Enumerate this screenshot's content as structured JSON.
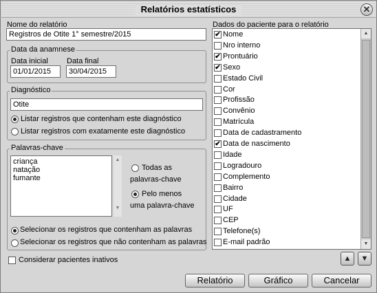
{
  "window": {
    "title": "Relatórios estatísticos",
    "close_icon": "close-icon"
  },
  "report_name": {
    "label": "Nome do relatório",
    "value": "Registros de Otite 1° semestre/2015"
  },
  "anamnese": {
    "legend": "Data da anamnese",
    "start_label": "Data inicial",
    "start_value": "01/01/2015",
    "end_label": "Data final",
    "end_value": "30/04/2015"
  },
  "diagnosis": {
    "legend": "Diagnóstico",
    "value": "Otite",
    "opt_contains": "Listar registros que contenham este diagnóstico",
    "opt_exact": "Listar registros com exatamente este diagnóstico",
    "selected": "contains"
  },
  "keywords": {
    "legend": "Palavras-chave",
    "words": [
      "criança",
      "natação",
      "fumante"
    ],
    "all_label_1": "Todas as",
    "all_label_2": "palavras-chave",
    "any_label_1": "Pelo menos",
    "any_label_2": "uma palavra-chave",
    "match_selected": "any",
    "opt_include": "Selecionar os registros que contenham as palavras",
    "opt_exclude": "Selecionar os registros que não contenham as palavras",
    "include_selected": "include"
  },
  "inactive": {
    "label": "Considerar pacientes inativos",
    "checked": false
  },
  "patient_fields": {
    "label": "Dados do paciente para o relatório",
    "items": [
      {
        "label": "Nome",
        "checked": true
      },
      {
        "label": "Nro interno",
        "checked": false
      },
      {
        "label": "Prontuário",
        "checked": true
      },
      {
        "label": "Sexo",
        "checked": true
      },
      {
        "label": "Estado Civil",
        "checked": false
      },
      {
        "label": "Cor",
        "checked": false
      },
      {
        "label": "Profissão",
        "checked": false
      },
      {
        "label": "Convênio",
        "checked": false
      },
      {
        "label": "Matrícula",
        "checked": false
      },
      {
        "label": "Data de cadastramento",
        "checked": false
      },
      {
        "label": "Data de nascimento",
        "checked": true
      },
      {
        "label": "Idade",
        "checked": false
      },
      {
        "label": "Logradouro",
        "checked": false
      },
      {
        "label": "Complemento",
        "checked": false
      },
      {
        "label": "Bairro",
        "checked": false
      },
      {
        "label": "Cidade",
        "checked": false
      },
      {
        "label": "UF",
        "checked": false
      },
      {
        "label": "CEP",
        "checked": false
      },
      {
        "label": "Telefone(s)",
        "checked": false
      },
      {
        "label": "E-mail padrão",
        "checked": false
      }
    ]
  },
  "buttons": {
    "report": "Relatório",
    "chart": "Gráfico",
    "cancel": "Cancelar"
  }
}
